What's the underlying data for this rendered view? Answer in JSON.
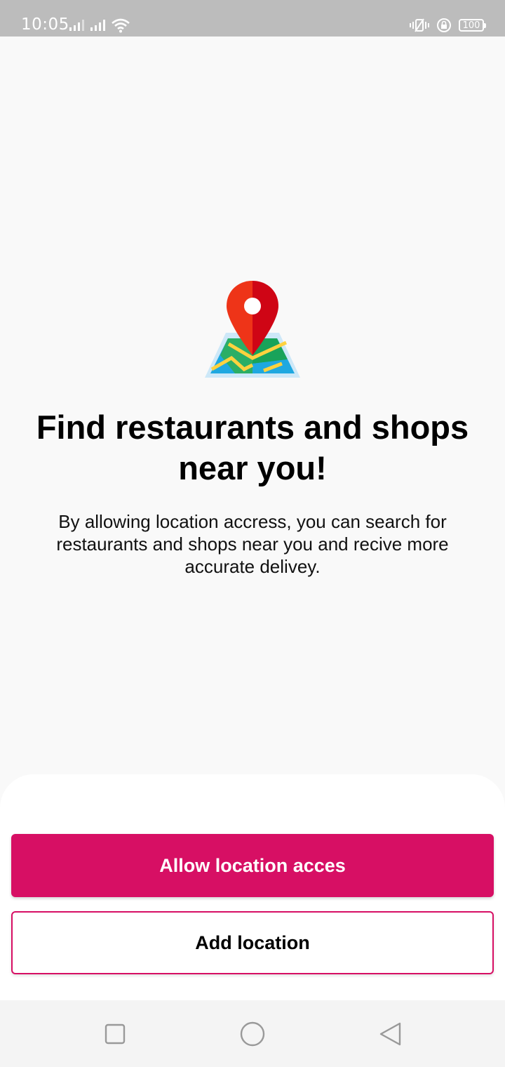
{
  "status_bar": {
    "time": "10:05",
    "battery": "100"
  },
  "main": {
    "headline_line1": "Find restaurants and shops",
    "headline_line2": "near you!",
    "description": "By allowing location accress, you can search for restaurants and shops near you and recive more accurate delivey."
  },
  "actions": {
    "allow_label": "Allow location acces",
    "add_label": "Add location"
  },
  "colors": {
    "accent": "#d70f64",
    "status_bar": "#bcbcbc"
  },
  "icons": {
    "illustration": "map-pin-icon",
    "nav_recents": "square-icon",
    "nav_home": "circle-icon",
    "nav_back": "triangle-back-icon"
  }
}
